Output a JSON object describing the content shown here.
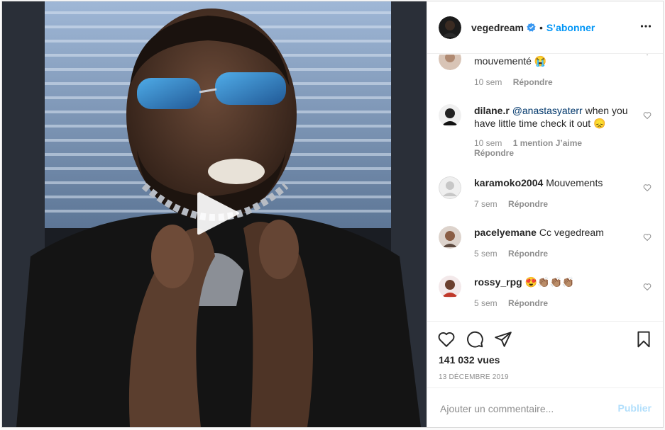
{
  "post": {
    "username": "vegedream",
    "follow_label": "S’abonner",
    "separator": "•",
    "more_icon": "more-horizontal-icon",
    "verified_icon": "verified-badge-icon"
  },
  "comments": [
    {
      "username": "",
      "text": "mouvementé 😭",
      "time": "10 sem",
      "likes": "",
      "reply": "Répondre"
    },
    {
      "username": "dilane.r",
      "mention": "@anastasyaterr",
      "text": " when you have little time check it out 😞",
      "time": "10 sem",
      "likes": "1 mention J’aime",
      "reply": "Répondre"
    },
    {
      "username": "karamoko2004",
      "text": "Mouvements",
      "time": "7 sem",
      "likes": "",
      "reply": "Répondre"
    },
    {
      "username": "pacelyemane",
      "text": "Cc vegedream",
      "time": "5 sem",
      "likes": "",
      "reply": "Répondre"
    },
    {
      "username": "rossy_rpg",
      "text": "😍👏🏽👏🏽👏🏽",
      "time": "5 sem",
      "likes": "",
      "reply": "Répondre"
    }
  ],
  "stats": {
    "views": "141 032 vues",
    "date": "13 décembre 2019"
  },
  "add_comment": {
    "placeholder": "Ajouter un commentaire...",
    "publish_label": "Publier"
  },
  "colors": {
    "accent": "#0095f6",
    "publish_disabled": "#b2dffc"
  }
}
